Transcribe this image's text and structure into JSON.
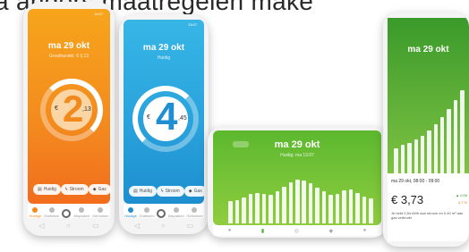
{
  "headline": "a anders maatregelen make",
  "phones": {
    "orange": {
      "status_time": "13:07",
      "date": "ma 29 okt",
      "sublabel": "Groothandel: € 0,13",
      "price_symbol": "€",
      "price_big": "2",
      "price_small": ",13",
      "pills": [
        "Huidig",
        "Stroom",
        "Gas"
      ],
      "tabs": [
        "Huidige",
        "Grafieken",
        "",
        "Afspraken",
        "Gebruiken"
      ],
      "color_top": "#f7a51c",
      "color_bottom": "#f26d1d"
    },
    "blue": {
      "status_time": "13:07",
      "date": "ma 29 okt",
      "sublabel": "Huidig",
      "price_symbol": "€",
      "price_big": "4",
      "price_small": ",45",
      "pills": [
        "Huidig",
        "Stroom",
        "Gas"
      ],
      "tabs": [
        "Huidige",
        "Grafieken",
        "",
        "Afspraken",
        "Gebruiken"
      ],
      "color_top": "#34b4e4",
      "color_bottom": "#1d8fd0"
    },
    "landscape": {
      "date": "ma 29 okt",
      "sublabel": "Huidig: ma 13:07",
      "bar_values": [
        0.38,
        0.4,
        0.44,
        0.5,
        0.52,
        0.5,
        0.48,
        0.55,
        0.62,
        0.7,
        0.75,
        0.72,
        0.68,
        0.6,
        0.55,
        0.48,
        0.5,
        0.56,
        0.58,
        0.52,
        0.45,
        0.42
      ],
      "color_top": "#5cb82e",
      "color_bottom": "#8fcd3f"
    },
    "right": {
      "date": "ma 29 okt",
      "time_range": "ma 29 okt, 08:00 - 09:00",
      "price": "€ 3,73",
      "change_up": "▲ 0,06",
      "change_pct": "0,7 %",
      "footnote": "Je hebt 0,54 kWh aan stroom en 0,40 m³ aan gas verbruikt",
      "bar_values": [
        0.25,
        0.28,
        0.3,
        0.33,
        0.37,
        0.42,
        0.48,
        0.55,
        0.63,
        0.72,
        0.82
      ],
      "color_top": "#3a9a2a",
      "color_bottom": "#7ec243"
    }
  }
}
